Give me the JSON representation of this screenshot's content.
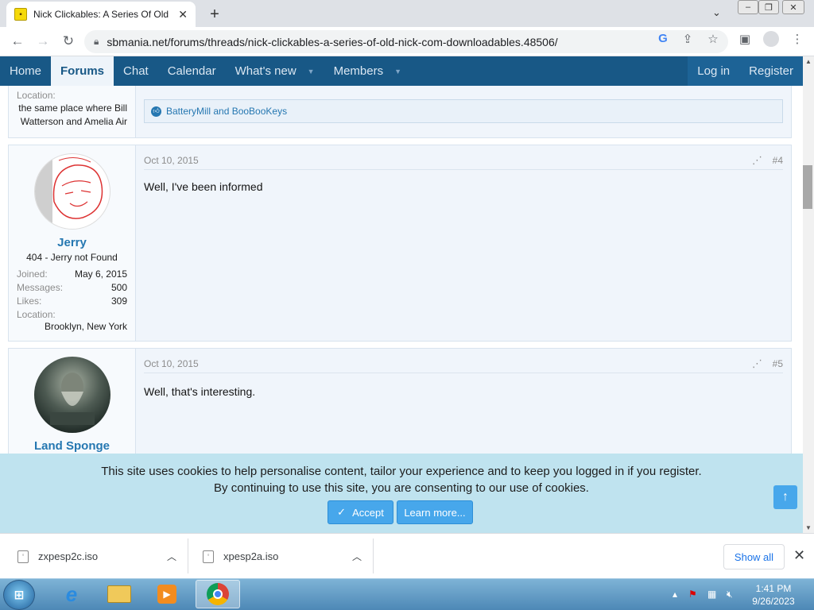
{
  "browser": {
    "tab_title": "Nick Clickables: A Series Of Old N",
    "url": "sbmania.net/forums/threads/nick-clickables-a-series-of-old-nick-com-downloadables.48506/"
  },
  "site_nav": {
    "items": [
      {
        "label": "Home"
      },
      {
        "label": "Forums"
      },
      {
        "label": "Chat"
      },
      {
        "label": "Calendar"
      },
      {
        "label": "What's new"
      },
      {
        "label": "Members"
      }
    ],
    "login": "Log in",
    "register": "Register"
  },
  "prev_post": {
    "location_label": "Location:",
    "location_line1": "the same place where Bill",
    "location_line2": "Watterson and Amelia Air",
    "reactions": "BatteryMill and BooBooKeys"
  },
  "posts": [
    {
      "username": "Jerry",
      "user_title": "404 - Jerry not Found",
      "stats": [
        {
          "label": "Joined:",
          "value": "May 6, 2015"
        },
        {
          "label": "Messages:",
          "value": "500"
        },
        {
          "label": "Likes:",
          "value": "309"
        },
        {
          "label": "Location:",
          "value": ""
        }
      ],
      "location": "Brooklyn, New York",
      "date": "Oct 10, 2015",
      "number": "#4",
      "body": "Well, I've been informed"
    },
    {
      "username": "Land Sponge",
      "date": "Oct 10, 2015",
      "number": "#5",
      "body": "Well, that's interesting."
    }
  ],
  "cookie": {
    "line1": "This site uses cookies to help personalise content, tailor your experience and to keep you logged in if you register.",
    "line2": "By continuing to use this site, you are consenting to our use of cookies.",
    "accept": "Accept",
    "learn_more": "Learn more..."
  },
  "downloads": {
    "items": [
      "zxpesp2c.iso",
      "xpesp2a.iso"
    ],
    "show_all": "Show all"
  },
  "taskbar": {
    "time": "1:41 PM",
    "date": "9/26/2023"
  }
}
